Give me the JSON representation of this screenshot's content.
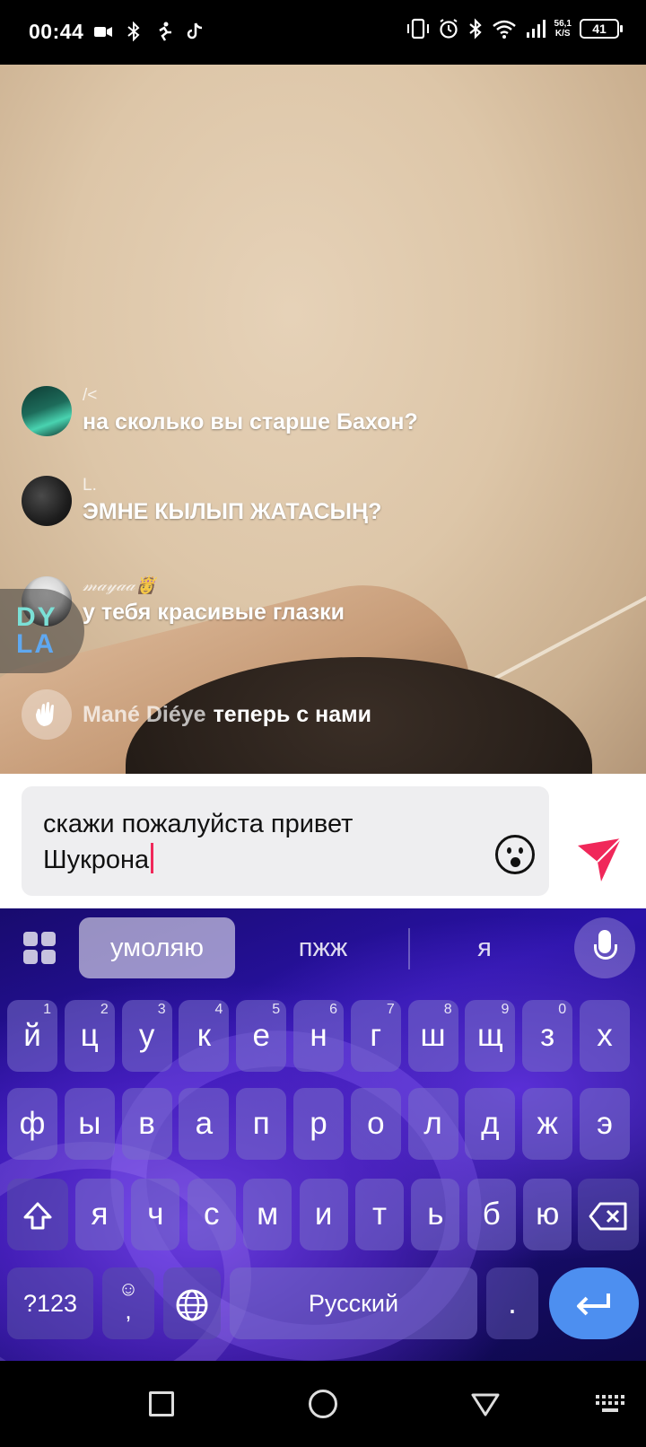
{
  "status_bar": {
    "time": "00:44",
    "net_speed_value": "56,1",
    "net_speed_unit": "K/S",
    "battery": "41"
  },
  "comments": [
    {
      "username": "/<",
      "text": "на сколько вы старше Бахон?"
    },
    {
      "username": "L.",
      "text": "ЭМНЕ КЫЛЫП ЖАТАСЫҢ?"
    },
    {
      "username": "𝓂𝒶𝓎𝒶𝒶👸",
      "text": "у тебя красивые глазки"
    }
  ],
  "join_notice": {
    "username": "Mané Diéye",
    "text": "теперь с нами"
  },
  "badge": {
    "line1": "DY",
    "line2": "LA"
  },
  "input": {
    "line1": "скажи пожалуйста привет",
    "line2": "Шукрона"
  },
  "keyboard": {
    "suggestions": [
      "умоляю",
      "пжж",
      "я"
    ],
    "row1": [
      {
        "k": "й",
        "h": "1"
      },
      {
        "k": "ц",
        "h": "2"
      },
      {
        "k": "у",
        "h": "3"
      },
      {
        "k": "к",
        "h": "4"
      },
      {
        "k": "е",
        "h": "5"
      },
      {
        "k": "н",
        "h": "6"
      },
      {
        "k": "г",
        "h": "7"
      },
      {
        "k": "ш",
        "h": "8"
      },
      {
        "k": "щ",
        "h": "9"
      },
      {
        "k": "з",
        "h": "0"
      },
      {
        "k": "х",
        "h": ""
      }
    ],
    "row2": [
      "ф",
      "ы",
      "в",
      "а",
      "п",
      "р",
      "о",
      "л",
      "д",
      "ж",
      "э"
    ],
    "row3": [
      "я",
      "ч",
      "с",
      "м",
      "и",
      "т",
      "ь",
      "б",
      "ю"
    ],
    "symbols_label": "?123",
    "comma_label": ",",
    "space_label": "Русский",
    "period_label": "."
  },
  "colors": {
    "caret": "#f0285a",
    "send": "#f0285a",
    "enter_key": "#4d8ff0"
  }
}
